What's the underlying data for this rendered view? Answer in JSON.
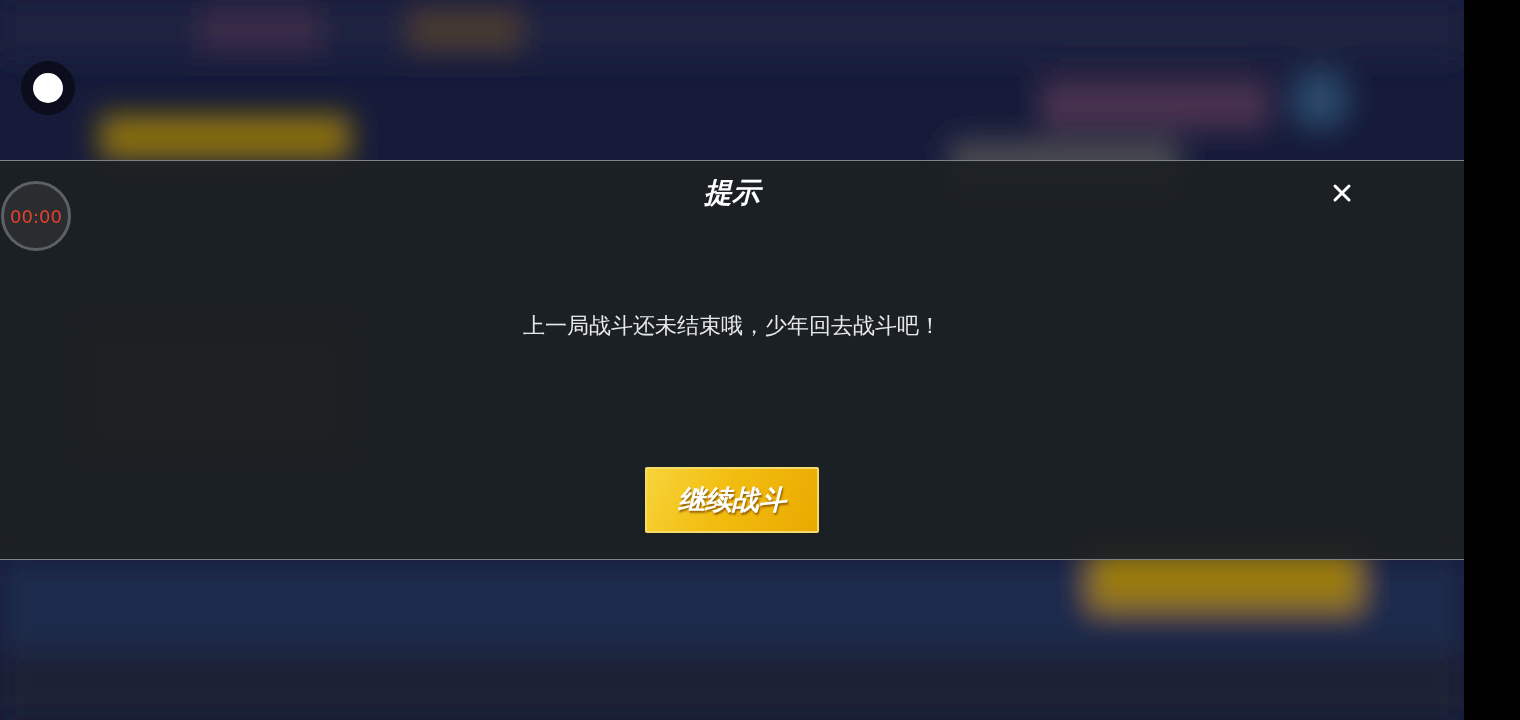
{
  "dialog": {
    "title": "提示",
    "message": "上一局战斗还未结束哦，少年回去战斗吧！",
    "button": "继续战斗"
  },
  "timer": {
    "text": "00:00"
  }
}
